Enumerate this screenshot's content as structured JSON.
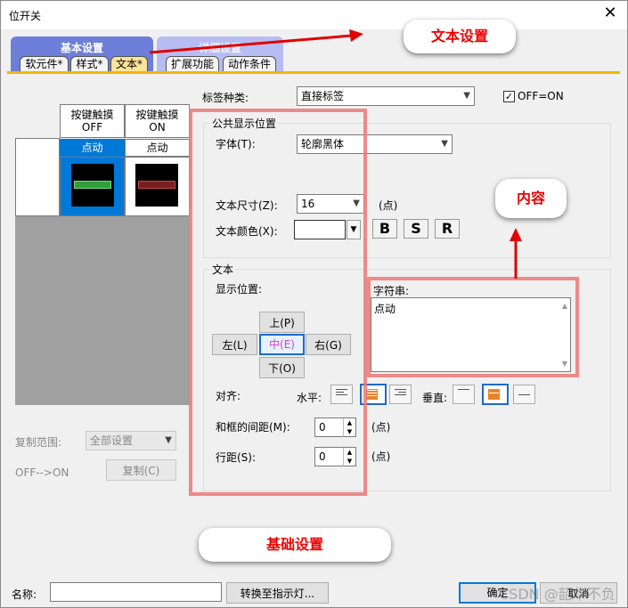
{
  "window": {
    "title": "位开关"
  },
  "tabs": {
    "group_basic": "基本设置",
    "group_detail": "详细设置",
    "basic": [
      "软元件*",
      "样式*",
      "文本*"
    ],
    "detail": [
      "扩展功能",
      "动作条件"
    ]
  },
  "preview": {
    "col_off": "按键触摸\nOFF",
    "col_on": "按键触摸\nON",
    "label_off": "点动",
    "label_on": "点动"
  },
  "left_bottom": {
    "copy_range_label": "复制范围:",
    "copy_range_value": "全部设置",
    "off_on_label": "OFF-->ON",
    "copy_button": "复制(C)"
  },
  "label_type": {
    "label": "标签种类:",
    "value": "直接标签",
    "checkbox_label": "OFF=ON",
    "checked": true
  },
  "common": {
    "group_title": "公共显示位置",
    "font_label": "字体(T):",
    "font_value": "轮廓黑体",
    "size_label": "文本尺寸(Z):",
    "size_value": "16",
    "size_unit": "(点)",
    "color_label": "文本颜色(X):",
    "style_buttons": [
      "B",
      "S",
      "R"
    ]
  },
  "text": {
    "group_title": "文本",
    "position_label": "显示位置:",
    "pos_up": "上(P)",
    "pos_left": "左(L)",
    "pos_center": "中(E)",
    "pos_right": "右(G)",
    "pos_down": "下(O)",
    "align_label": "对齐:",
    "horizontal_label": "水平:",
    "vertical_label": "垂直:",
    "margin_label": "和框的间距(M):",
    "margin_value": "0",
    "margin_unit": "(点)",
    "line_spacing_label": "行距(S):",
    "line_spacing_value": "0",
    "line_spacing_unit": "(点)",
    "string_label": "字符串:",
    "string_value": "点动"
  },
  "callouts": {
    "text_setting": "文本设置",
    "content": "内容",
    "basic_setting": "基础设置"
  },
  "bottom": {
    "name_label": "名称:",
    "name_value": "",
    "convert_button": "转换至指示灯...",
    "ok_button": "确定",
    "cancel_button": "取消",
    "watermark": "CSDN @韶华不负"
  },
  "colors": {
    "accent_tab": "#fde39a",
    "callout_text": "#e00000",
    "highlight_box": "#eb7878",
    "selection_blue": "#0078d7"
  }
}
